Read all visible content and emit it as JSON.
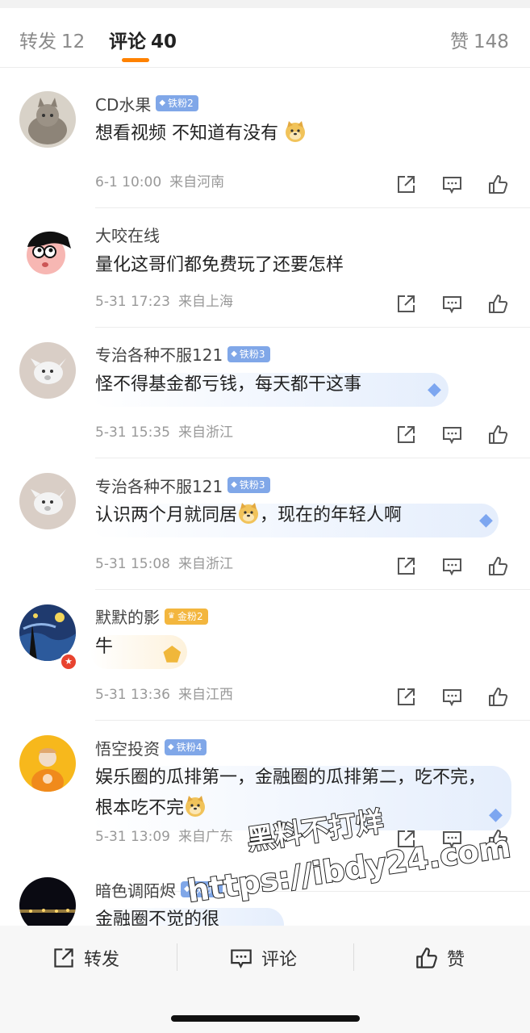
{
  "tabs": {
    "repost_label": "转发",
    "repost_count": "12",
    "comment_label": "评论",
    "comment_count": "40",
    "like_label": "赞",
    "like_count": "148"
  },
  "comments": [
    {
      "name": "CD水果",
      "fan_badge": "铁粉2",
      "text": "想看视频 不知道有没有",
      "time": "6-1 10:00",
      "location": "来自河南"
    },
    {
      "name": "大咬在线",
      "fan_badge": "",
      "text": "量化这哥们都免费玩了还要怎样",
      "time": "5-31 17:23",
      "location": "来自上海"
    },
    {
      "name": "专治各种不服121",
      "fan_badge": "铁粉3",
      "text": "怪不得基金都亏钱，每天都干这事",
      "time": "5-31 15:35",
      "location": "来自浙江"
    },
    {
      "name": "专治各种不服121",
      "fan_badge": "铁粉3",
      "text": "认识两个月就同居",
      "text_after": "，现在的年轻人啊",
      "time": "5-31 15:08",
      "location": "来自浙江"
    },
    {
      "name": "默默的影",
      "fan_badge": "金粉2",
      "text": "牛",
      "time": "5-31 13:36",
      "location": "来自江西"
    },
    {
      "name": "悟空投资",
      "fan_badge": "铁粉4",
      "text": "娱乐圈的瓜排第一，金融圈的瓜排第二，吃不完，根本吃不完",
      "time": "5-31 13:09",
      "location": "来自广东"
    },
    {
      "name": "暗色调陌烬",
      "fan_badge": "铁粉5",
      "text": "金融圈不觉的很",
      "time": "",
      "location": ""
    }
  ],
  "bottom_bar": {
    "repost": "转发",
    "comment": "评论",
    "like": "赞"
  },
  "watermark": {
    "line1": "黑料不打烊",
    "line2": "https://ibdy24.com"
  },
  "colors": {
    "accent": "#ff8200",
    "iron_badge": "#80a7e8",
    "gold_badge": "#f3b63e",
    "v_badge": "#e8432f"
  }
}
